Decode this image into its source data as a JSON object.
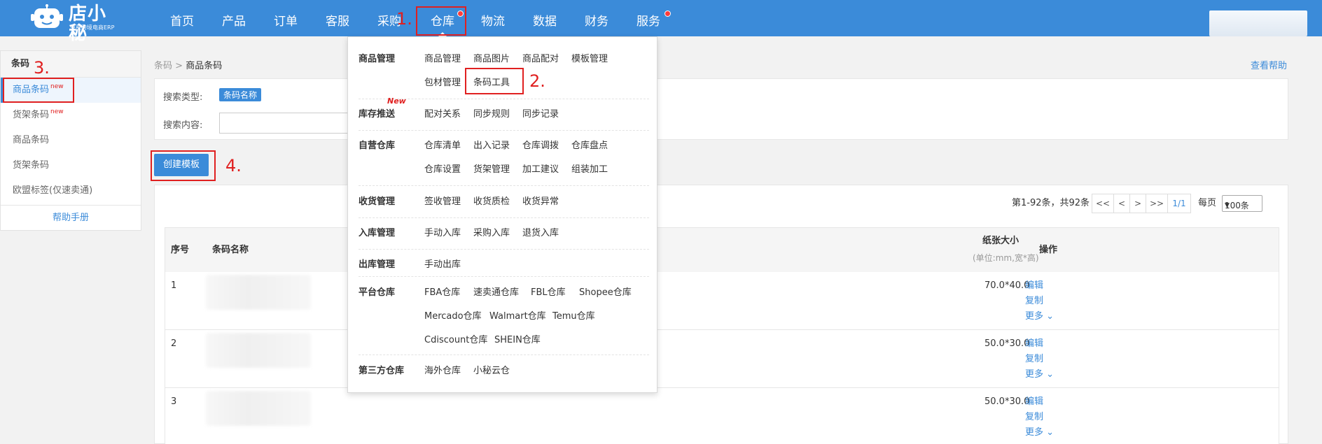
{
  "app": {
    "logo_name": "店小秘",
    "logo_sub": "免费跨境电商ERP"
  },
  "nav": {
    "items": [
      "首页",
      "产品",
      "订单",
      "客服",
      "采购",
      "仓库",
      "物流",
      "数据",
      "财务",
      "服务"
    ]
  },
  "annotations": [
    "1.",
    "2.",
    "3.",
    "4."
  ],
  "sidebar": {
    "title": "条码",
    "items": [
      {
        "label": "商品条码",
        "badge": "new"
      },
      {
        "label": "货架条码",
        "badge": "new"
      },
      {
        "label": "商品条码"
      },
      {
        "label": "货架条码"
      },
      {
        "label": "欧盟标签(仅速卖通)"
      }
    ],
    "help": "帮助手册"
  },
  "breadcrumb": {
    "parent": "条码",
    "sep": ">",
    "current": "商品条码"
  },
  "help_link": "查看帮助",
  "search": {
    "type_label": "搜索类型:",
    "type_tag": "条码名称",
    "content_label": "搜索内容:",
    "content_value": ""
  },
  "create_button": "创建模板",
  "pager": {
    "summary": "第1-92条，共92条",
    "first": "<<",
    "prev": "<",
    "next": ">",
    "last": ">>",
    "page": "1/1",
    "per_page_label": "每页",
    "per_page_value": "100条"
  },
  "table": {
    "headers": {
      "index": "序号",
      "name": "条码名称",
      "size": "纸张大小",
      "size_unit": "(单位:mm,宽*高)",
      "ops": "操作"
    },
    "rows": [
      {
        "index": "1",
        "size": "70.0*40.0"
      },
      {
        "index": "2",
        "size": "50.0*30.0"
      },
      {
        "index": "3",
        "size": "50.0*30.0"
      }
    ],
    "ops": {
      "edit": "编辑",
      "copy": "复制",
      "more": "更多"
    }
  },
  "mega_menu": {
    "sections": [
      {
        "title": "商品管理",
        "links": [
          "商品管理",
          "商品图片",
          "商品配对",
          "模板管理",
          "包材管理",
          "条码工具"
        ]
      },
      {
        "title": "库存推送",
        "badge": "New",
        "links": [
          "配对关系",
          "同步规则",
          "同步记录"
        ]
      },
      {
        "title": "自营仓库",
        "links": [
          "仓库清单",
          "出入记录",
          "仓库调拨",
          "仓库盘点",
          "仓库设置",
          "货架管理",
          "加工建议",
          "组装加工"
        ]
      },
      {
        "title": "收货管理",
        "links": [
          "签收管理",
          "收货质检",
          "收货异常"
        ]
      },
      {
        "title": "入库管理",
        "links": [
          "手动入库",
          "采购入库",
          "退货入库"
        ]
      },
      {
        "title": "出库管理",
        "links": [
          "手动出库"
        ]
      },
      {
        "title": "平台仓库",
        "links": [
          "FBA仓库",
          "速卖通仓库",
          "FBL仓库",
          "Shopee仓库",
          "Mercado仓库",
          "Walmart仓库",
          "Temu仓库",
          "Cdiscount仓库",
          "SHEIN仓库"
        ]
      },
      {
        "title": "第三方仓库",
        "links": [
          "海外仓库",
          "小秘云仓"
        ]
      }
    ]
  },
  "colors": {
    "primary": "#3b8bd9",
    "annotation": "#e02020",
    "badge_dot": "#ff3b3b"
  }
}
